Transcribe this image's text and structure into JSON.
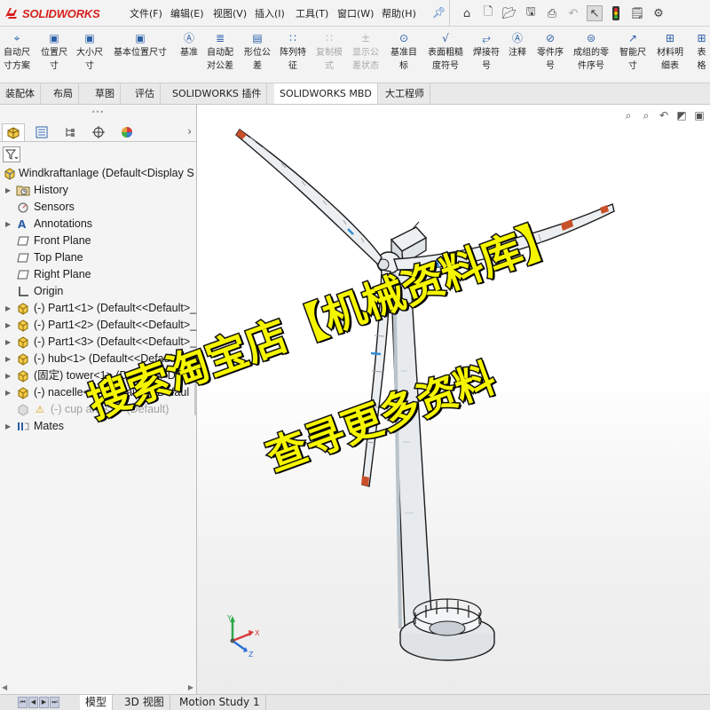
{
  "app": {
    "brand": "SOLIDWORKS"
  },
  "menu": [
    "文件(F)",
    "编辑(E)",
    "视图(V)",
    "插入(I)",
    "工具(T)",
    "窗口(W)",
    "帮助(H)"
  ],
  "commands": [
    {
      "l1": "自动尺",
      "l2": "寸方案",
      "icon": "auto-dimension-icon",
      "enabled": true
    },
    {
      "l1": "位置尺",
      "l2": "寸",
      "icon": "location-dimension-icon",
      "enabled": true
    },
    {
      "l1": "大小尺",
      "l2": "寸",
      "icon": "size-dimension-icon",
      "enabled": true
    },
    {
      "l1": "基本位置尺寸",
      "l2": "",
      "icon": "basic-location-dimension-icon",
      "enabled": true
    },
    {
      "l1": "基准",
      "l2": "",
      "icon": "datum-icon",
      "enabled": true
    },
    {
      "l1": "自动配",
      "l2": "对公差",
      "icon": "auto-pair-tolerance-icon",
      "enabled": true
    },
    {
      "l1": "形位公",
      "l2": "差",
      "icon": "geometric-tolerance-icon",
      "enabled": true
    },
    {
      "l1": "阵列特",
      "l2": "征",
      "icon": "pattern-feature-icon",
      "enabled": true
    },
    {
      "l1": "复制模",
      "l2": "式",
      "icon": "copy-scheme-icon",
      "enabled": false
    },
    {
      "l1": "显示公",
      "l2": "差状态",
      "icon": "show-tolerance-status-icon",
      "enabled": false
    },
    {
      "l1": "基准目",
      "l2": "标",
      "icon": "datum-target-icon",
      "enabled": true
    },
    {
      "l1": "表面粗糙",
      "l2": "度符号",
      "icon": "surface-finish-icon",
      "enabled": true
    },
    {
      "l1": "焊接符",
      "l2": "号",
      "icon": "weld-symbol-icon",
      "enabled": true
    },
    {
      "l1": "注释",
      "l2": "",
      "icon": "note-icon",
      "enabled": true
    },
    {
      "l1": "零件序",
      "l2": "号",
      "icon": "balloon-icon",
      "enabled": true
    },
    {
      "l1": "成组的零",
      "l2": "件序号",
      "icon": "stacked-balloon-icon",
      "enabled": true
    },
    {
      "l1": "智能尺",
      "l2": "寸",
      "icon": "smart-dimension-icon",
      "enabled": true
    },
    {
      "l1": "材料明",
      "l2": "细表",
      "icon": "bill-of-materials-icon",
      "enabled": true
    },
    {
      "l1": "表格",
      "l2": "",
      "icon": "table-icon",
      "enabled": true
    }
  ],
  "tabs": [
    "装配体",
    "布局",
    "草图",
    "评估",
    "SOLIDWORKS 插件",
    "SOLIDWORKS MBD",
    "大工程师"
  ],
  "active_tab": "SOLIDWORKS MBD",
  "tree": {
    "root": "Windkraftanlage  (Default<Display S",
    "items": [
      {
        "label": "History",
        "icon": "history-folder-icon",
        "expandable": true
      },
      {
        "label": "Sensors",
        "icon": "sensors-icon",
        "expandable": false
      },
      {
        "label": "Annotations",
        "icon": "annotations-icon",
        "expandable": true
      },
      {
        "label": "Front Plane",
        "icon": "plane-icon",
        "expandable": false
      },
      {
        "label": "Top Plane",
        "icon": "plane-icon",
        "expandable": false
      },
      {
        "label": "Right Plane",
        "icon": "plane-icon",
        "expandable": false
      },
      {
        "label": "Origin",
        "icon": "origin-icon",
        "expandable": false
      },
      {
        "label": "(-) Part1<1> (Default<<Default>_",
        "icon": "part-icon",
        "expandable": true
      },
      {
        "label": "(-) Part1<2> (Default<<Default>_",
        "icon": "part-icon",
        "expandable": true
      },
      {
        "label": "(-) Part1<3> (Default<<Default>_",
        "icon": "part-icon",
        "expandable": true
      },
      {
        "label": "(-) hub<1> (Default<<Default>_Di",
        "icon": "part-icon",
        "expandable": true
      },
      {
        "label": "(固定) tower<1> (Default<<Defa",
        "icon": "part-icon",
        "expandable": true
      },
      {
        "label": "(-) nacelle<1> (Default<<Defaul",
        "icon": "part-icon",
        "expandable": true
      },
      {
        "label": "(-) cup ann<1> (Default)",
        "icon": "suppressed-part-warning-icon",
        "expandable": false,
        "suppressed": true
      },
      {
        "label": "Mates",
        "icon": "mates-icon",
        "expandable": true
      }
    ]
  },
  "bottom_tabs": [
    "模型",
    "3D 视图",
    "Motion Study 1"
  ],
  "watermark": {
    "line1": "搜索淘宝店【机械资料库】",
    "line2": "查寻更多资料"
  },
  "triad": {
    "x": "X",
    "y": "Y",
    "z": "Z"
  },
  "colors": {
    "brand_red": "#d6211e",
    "blade_tip": "#c8502a",
    "watermark_fill": "#f5f500"
  }
}
